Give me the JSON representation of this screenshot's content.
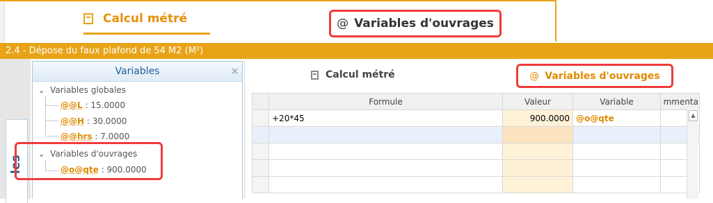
{
  "top": {
    "tab_calc": "Calcul métré",
    "tab_vars": "Variables d'ouvrages"
  },
  "title_bar": "2.4 - Dépose du faux plafond de 54 M2 (M²)",
  "side_tab": "les",
  "variables_panel": {
    "header": "Variables",
    "close": "✕",
    "groups": [
      {
        "label": "Variables globales",
        "items": [
          {
            "name": "@@L",
            "value": " : 15.0000"
          },
          {
            "name": "@@H",
            "value": " : 30.0000"
          },
          {
            "name": "@@hrs",
            "value": " : 7.0000"
          }
        ]
      },
      {
        "label": "Variables d'ouvrages",
        "items": [
          {
            "name": "@o@qte",
            "value": " : 900.0000"
          }
        ]
      }
    ]
  },
  "right_panel": {
    "tab_calc": "Calcul métré",
    "tab_vars": "Variables d'ouvrages",
    "columns": [
      "Formule",
      "Valeur",
      "Variable",
      "mmenta"
    ],
    "rows": [
      {
        "formule": "+20*45",
        "valeur": "900.0000",
        "variable": "@o@qte",
        "comment": ""
      }
    ]
  },
  "colors": {
    "accent": "#e8a317",
    "highlight": "#ef3b3b",
    "link_blue": "#1c5f96"
  }
}
